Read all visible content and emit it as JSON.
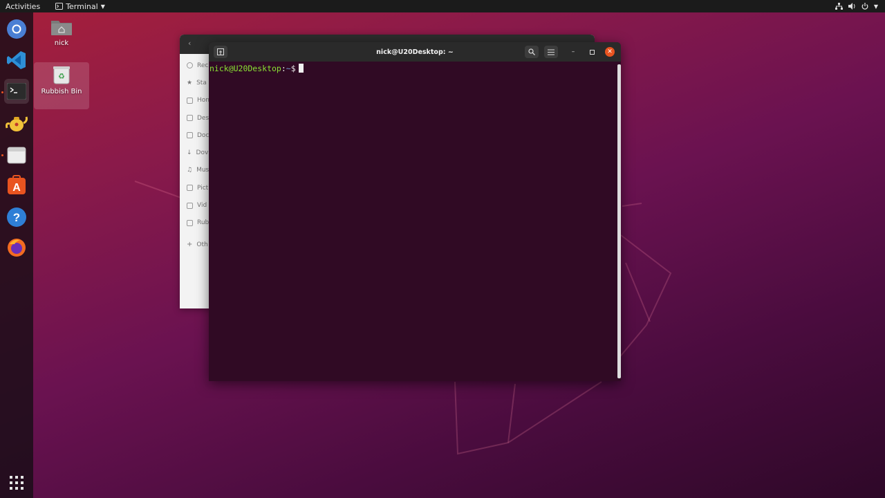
{
  "topbar": {
    "activities": "Activities",
    "app_name": "Terminal",
    "tray_icons": [
      "network-icon",
      "volume-icon",
      "power-icon"
    ]
  },
  "dock": {
    "items": [
      {
        "name": "chromium",
        "icon": "chromium-icon"
      },
      {
        "name": "vscode",
        "icon": "vscode-icon"
      },
      {
        "name": "terminal",
        "icon": "terminal-icon",
        "active": true
      },
      {
        "name": "teapot",
        "icon": "teapot-icon"
      },
      {
        "name": "files",
        "icon": "files-icon"
      },
      {
        "name": "software",
        "icon": "software-icon"
      },
      {
        "name": "help",
        "icon": "help-icon"
      },
      {
        "name": "firefox",
        "icon": "firefox-icon"
      }
    ],
    "apps_grid_icon": "apps-grid-icon"
  },
  "desktop": {
    "home_label": "nick",
    "trash_label": "Rubbish Bin"
  },
  "files_window": {
    "sidebar": [
      "Rec",
      "Sta",
      "Hon",
      "Des",
      "Doc",
      "Dov",
      "Mus",
      "Pict",
      "Vid",
      "Rub",
      "Oth"
    ]
  },
  "terminal": {
    "title": "nick@U20Desktop: ~",
    "prompt_user": "nick@U20Desktop",
    "prompt_sep": ":",
    "prompt_path": "~",
    "prompt_symbol": "$"
  },
  "colors": {
    "accent": "#e95420",
    "terminal_bg": "#300a24",
    "prompt_green": "#8ae234",
    "prompt_blue": "#729fcf"
  }
}
